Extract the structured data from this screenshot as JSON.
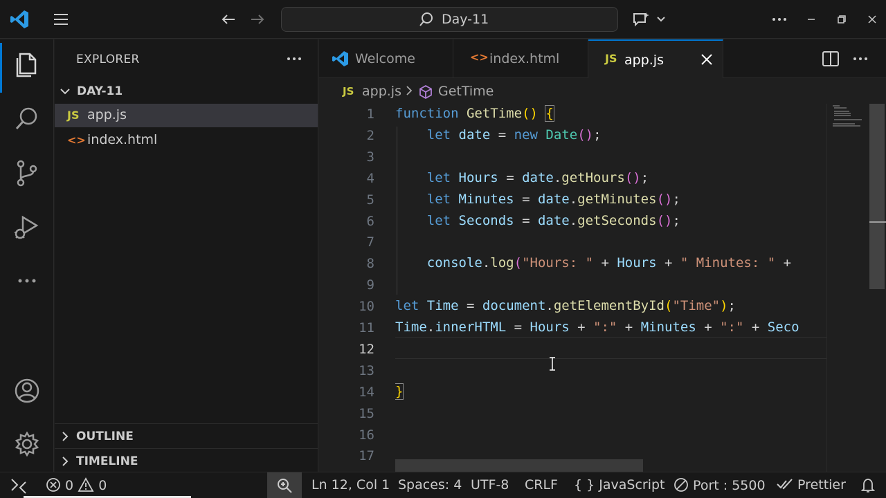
{
  "titlebar": {
    "search_text": "Day-11",
    "icons": [
      "vscode-logo-icon",
      "menu-icon",
      "back-arrow-icon",
      "forward-arrow-icon",
      "search-icon",
      "copilot-icon",
      "more-icon",
      "minimize-icon",
      "restore-icon",
      "close-icon"
    ]
  },
  "activitybar": {
    "items": [
      "explorer-icon",
      "search-icon",
      "source-control-icon",
      "run-debug-icon",
      "more-icon",
      "account-icon",
      "settings-icon"
    ]
  },
  "sidebar": {
    "title": "EXPLORER",
    "folder": "DAY-11",
    "files": [
      {
        "icon": "JS",
        "name": "app.js",
        "selected": true,
        "color": "#cbcb41"
      },
      {
        "icon": "<>",
        "name": "index.html",
        "selected": false,
        "color": "#e37933"
      }
    ],
    "outline": "OUTLINE",
    "timeline": "TIMELINE"
  },
  "tabs": [
    {
      "label": "Welcome",
      "icon": "vscode-icon",
      "active": false
    },
    {
      "label": "index.html",
      "icon": "<>",
      "active": false
    },
    {
      "label": "app.js",
      "icon": "JS",
      "active": true
    }
  ],
  "breadcrumb": {
    "file_icon": "JS",
    "file": "app.js",
    "symbol": "GetTime"
  },
  "editor": {
    "current_line": 12,
    "line_numbers": [
      "1",
      "2",
      "3",
      "4",
      "5",
      "6",
      "7",
      "8",
      "9",
      "10",
      "11",
      "12",
      "13",
      "14",
      "15",
      "16",
      "17"
    ],
    "lines": [
      [
        [
          "kw",
          "function"
        ],
        [
          "op",
          " "
        ],
        [
          "fn",
          "GetTime"
        ],
        [
          "br1",
          "()"
        ],
        [
          "op",
          " "
        ],
        [
          "br1",
          "{"
        ]
      ],
      [
        [
          "op",
          "    "
        ],
        [
          "kw",
          "let"
        ],
        [
          "op",
          " "
        ],
        [
          "var",
          "date"
        ],
        [
          "op",
          " = "
        ],
        [
          "kw",
          "new"
        ],
        [
          "op",
          " "
        ],
        [
          "cls",
          "Date"
        ],
        [
          "br2",
          "()"
        ],
        [
          "op",
          ";"
        ]
      ],
      [],
      [
        [
          "op",
          "    "
        ],
        [
          "kw",
          "let"
        ],
        [
          "op",
          " "
        ],
        [
          "var",
          "Hours"
        ],
        [
          "op",
          " = "
        ],
        [
          "var",
          "date"
        ],
        [
          "op",
          "."
        ],
        [
          "fn",
          "getHours"
        ],
        [
          "br2",
          "()"
        ],
        [
          "op",
          ";"
        ]
      ],
      [
        [
          "op",
          "    "
        ],
        [
          "kw",
          "let"
        ],
        [
          "op",
          " "
        ],
        [
          "var",
          "Minutes"
        ],
        [
          "op",
          " = "
        ],
        [
          "var",
          "date"
        ],
        [
          "op",
          "."
        ],
        [
          "fn",
          "getMinutes"
        ],
        [
          "br2",
          "()"
        ],
        [
          "op",
          ";"
        ]
      ],
      [
        [
          "op",
          "    "
        ],
        [
          "kw",
          "let"
        ],
        [
          "op",
          " "
        ],
        [
          "var",
          "Seconds"
        ],
        [
          "op",
          " = "
        ],
        [
          "var",
          "date"
        ],
        [
          "op",
          "."
        ],
        [
          "fn",
          "getSeconds"
        ],
        [
          "br2",
          "()"
        ],
        [
          "op",
          ";"
        ]
      ],
      [],
      [
        [
          "op",
          "    "
        ],
        [
          "var",
          "console"
        ],
        [
          "op",
          "."
        ],
        [
          "fn",
          "log"
        ],
        [
          "br2",
          "("
        ],
        [
          "str",
          "\"Hours: \""
        ],
        [
          "op",
          " + "
        ],
        [
          "var",
          "Hours"
        ],
        [
          "op",
          " + "
        ],
        [
          "str",
          "\" Minutes: \""
        ],
        [
          "op",
          " + "
        ]
      ],
      [],
      [
        [
          "kw",
          "let"
        ],
        [
          "op",
          " "
        ],
        [
          "var",
          "Time"
        ],
        [
          "op",
          " = "
        ],
        [
          "var",
          "document"
        ],
        [
          "op",
          "."
        ],
        [
          "fn",
          "getElementById"
        ],
        [
          "br1",
          "("
        ],
        [
          "str",
          "\"Time\""
        ],
        [
          "br1",
          ")"
        ],
        [
          "op",
          ";"
        ]
      ],
      [
        [
          "var",
          "Time"
        ],
        [
          "op",
          "."
        ],
        [
          "var",
          "innerHTML"
        ],
        [
          "op",
          " = "
        ],
        [
          "var",
          "Hours"
        ],
        [
          "op",
          " + "
        ],
        [
          "str",
          "\":\""
        ],
        [
          "op",
          " + "
        ],
        [
          "var",
          "Minutes"
        ],
        [
          "op",
          " + "
        ],
        [
          "str",
          "\":\""
        ],
        [
          "op",
          " + "
        ],
        [
          "var",
          "Seco"
        ]
      ],
      [],
      [],
      [
        [
          "br1",
          "}"
        ]
      ],
      [],
      [],
      []
    ]
  },
  "statusbar": {
    "errors": "0",
    "warnings": "0",
    "position": "Ln 12, Col 1",
    "spaces": "Spaces: 4",
    "encoding": "UTF-8",
    "eol": "CRLF",
    "language": "JavaScript",
    "port": "Port : 5500",
    "formatter": "Prettier"
  },
  "colors": {
    "accent": "#0078d4",
    "js_icon": "#cbcb41",
    "html_icon": "#e37933"
  }
}
